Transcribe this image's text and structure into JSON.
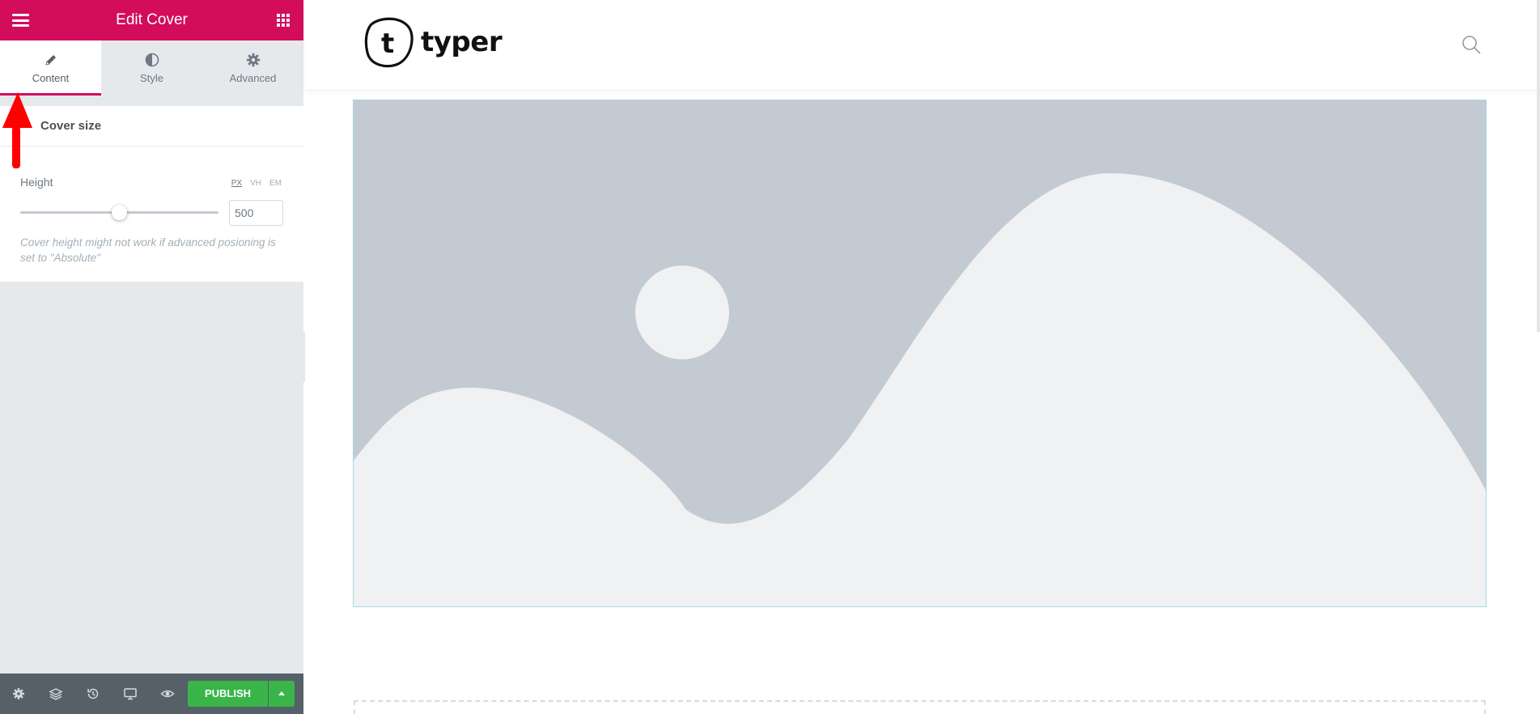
{
  "editor": {
    "title": "Edit Cover",
    "tabs": [
      {
        "label": "Content",
        "icon": "pencil-icon",
        "active": true
      },
      {
        "label": "Style",
        "icon": "contrast-icon",
        "active": false
      },
      {
        "label": "Advanced",
        "icon": "gear-icon",
        "active": false
      }
    ],
    "section_title": "Cover size",
    "height_control": {
      "label": "Height",
      "units": [
        "PX",
        "VH",
        "EM"
      ],
      "active_unit": "PX",
      "value": "500",
      "slider_fraction": 0.5
    },
    "note": "Cover height might not work if advanced posioning is set to \"Absolute\"",
    "publish_label": "PUBLISH"
  },
  "site": {
    "logo_text": "typer",
    "logo_mark": "t"
  },
  "colors": {
    "brand": "#d30c5c",
    "publish": "#39b54a",
    "bottombar": "#556068",
    "sidebar_bg": "#e6e9ec",
    "cover_bg": "#c3cad2",
    "annotation_arrow": "#ff0000"
  }
}
